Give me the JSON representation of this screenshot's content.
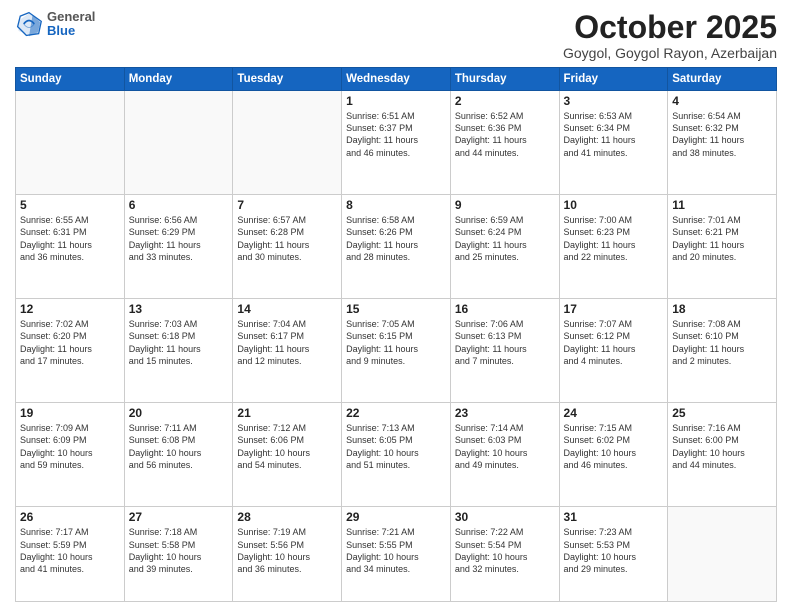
{
  "header": {
    "logo_general": "General",
    "logo_blue": "Blue",
    "month_title": "October 2025",
    "location": "Goygol, Goygol Rayon, Azerbaijan"
  },
  "days_of_week": [
    "Sunday",
    "Monday",
    "Tuesday",
    "Wednesday",
    "Thursday",
    "Friday",
    "Saturday"
  ],
  "weeks": [
    [
      {
        "day": "",
        "info": ""
      },
      {
        "day": "",
        "info": ""
      },
      {
        "day": "",
        "info": ""
      },
      {
        "day": "1",
        "info": "Sunrise: 6:51 AM\nSunset: 6:37 PM\nDaylight: 11 hours\nand 46 minutes."
      },
      {
        "day": "2",
        "info": "Sunrise: 6:52 AM\nSunset: 6:36 PM\nDaylight: 11 hours\nand 44 minutes."
      },
      {
        "day": "3",
        "info": "Sunrise: 6:53 AM\nSunset: 6:34 PM\nDaylight: 11 hours\nand 41 minutes."
      },
      {
        "day": "4",
        "info": "Sunrise: 6:54 AM\nSunset: 6:32 PM\nDaylight: 11 hours\nand 38 minutes."
      }
    ],
    [
      {
        "day": "5",
        "info": "Sunrise: 6:55 AM\nSunset: 6:31 PM\nDaylight: 11 hours\nand 36 minutes."
      },
      {
        "day": "6",
        "info": "Sunrise: 6:56 AM\nSunset: 6:29 PM\nDaylight: 11 hours\nand 33 minutes."
      },
      {
        "day": "7",
        "info": "Sunrise: 6:57 AM\nSunset: 6:28 PM\nDaylight: 11 hours\nand 30 minutes."
      },
      {
        "day": "8",
        "info": "Sunrise: 6:58 AM\nSunset: 6:26 PM\nDaylight: 11 hours\nand 28 minutes."
      },
      {
        "day": "9",
        "info": "Sunrise: 6:59 AM\nSunset: 6:24 PM\nDaylight: 11 hours\nand 25 minutes."
      },
      {
        "day": "10",
        "info": "Sunrise: 7:00 AM\nSunset: 6:23 PM\nDaylight: 11 hours\nand 22 minutes."
      },
      {
        "day": "11",
        "info": "Sunrise: 7:01 AM\nSunset: 6:21 PM\nDaylight: 11 hours\nand 20 minutes."
      }
    ],
    [
      {
        "day": "12",
        "info": "Sunrise: 7:02 AM\nSunset: 6:20 PM\nDaylight: 11 hours\nand 17 minutes."
      },
      {
        "day": "13",
        "info": "Sunrise: 7:03 AM\nSunset: 6:18 PM\nDaylight: 11 hours\nand 15 minutes."
      },
      {
        "day": "14",
        "info": "Sunrise: 7:04 AM\nSunset: 6:17 PM\nDaylight: 11 hours\nand 12 minutes."
      },
      {
        "day": "15",
        "info": "Sunrise: 7:05 AM\nSunset: 6:15 PM\nDaylight: 11 hours\nand 9 minutes."
      },
      {
        "day": "16",
        "info": "Sunrise: 7:06 AM\nSunset: 6:13 PM\nDaylight: 11 hours\nand 7 minutes."
      },
      {
        "day": "17",
        "info": "Sunrise: 7:07 AM\nSunset: 6:12 PM\nDaylight: 11 hours\nand 4 minutes."
      },
      {
        "day": "18",
        "info": "Sunrise: 7:08 AM\nSunset: 6:10 PM\nDaylight: 11 hours\nand 2 minutes."
      }
    ],
    [
      {
        "day": "19",
        "info": "Sunrise: 7:09 AM\nSunset: 6:09 PM\nDaylight: 10 hours\nand 59 minutes."
      },
      {
        "day": "20",
        "info": "Sunrise: 7:11 AM\nSunset: 6:08 PM\nDaylight: 10 hours\nand 56 minutes."
      },
      {
        "day": "21",
        "info": "Sunrise: 7:12 AM\nSunset: 6:06 PM\nDaylight: 10 hours\nand 54 minutes."
      },
      {
        "day": "22",
        "info": "Sunrise: 7:13 AM\nSunset: 6:05 PM\nDaylight: 10 hours\nand 51 minutes."
      },
      {
        "day": "23",
        "info": "Sunrise: 7:14 AM\nSunset: 6:03 PM\nDaylight: 10 hours\nand 49 minutes."
      },
      {
        "day": "24",
        "info": "Sunrise: 7:15 AM\nSunset: 6:02 PM\nDaylight: 10 hours\nand 46 minutes."
      },
      {
        "day": "25",
        "info": "Sunrise: 7:16 AM\nSunset: 6:00 PM\nDaylight: 10 hours\nand 44 minutes."
      }
    ],
    [
      {
        "day": "26",
        "info": "Sunrise: 7:17 AM\nSunset: 5:59 PM\nDaylight: 10 hours\nand 41 minutes."
      },
      {
        "day": "27",
        "info": "Sunrise: 7:18 AM\nSunset: 5:58 PM\nDaylight: 10 hours\nand 39 minutes."
      },
      {
        "day": "28",
        "info": "Sunrise: 7:19 AM\nSunset: 5:56 PM\nDaylight: 10 hours\nand 36 minutes."
      },
      {
        "day": "29",
        "info": "Sunrise: 7:21 AM\nSunset: 5:55 PM\nDaylight: 10 hours\nand 34 minutes."
      },
      {
        "day": "30",
        "info": "Sunrise: 7:22 AM\nSunset: 5:54 PM\nDaylight: 10 hours\nand 32 minutes."
      },
      {
        "day": "31",
        "info": "Sunrise: 7:23 AM\nSunset: 5:53 PM\nDaylight: 10 hours\nand 29 minutes."
      },
      {
        "day": "",
        "info": ""
      }
    ]
  ]
}
